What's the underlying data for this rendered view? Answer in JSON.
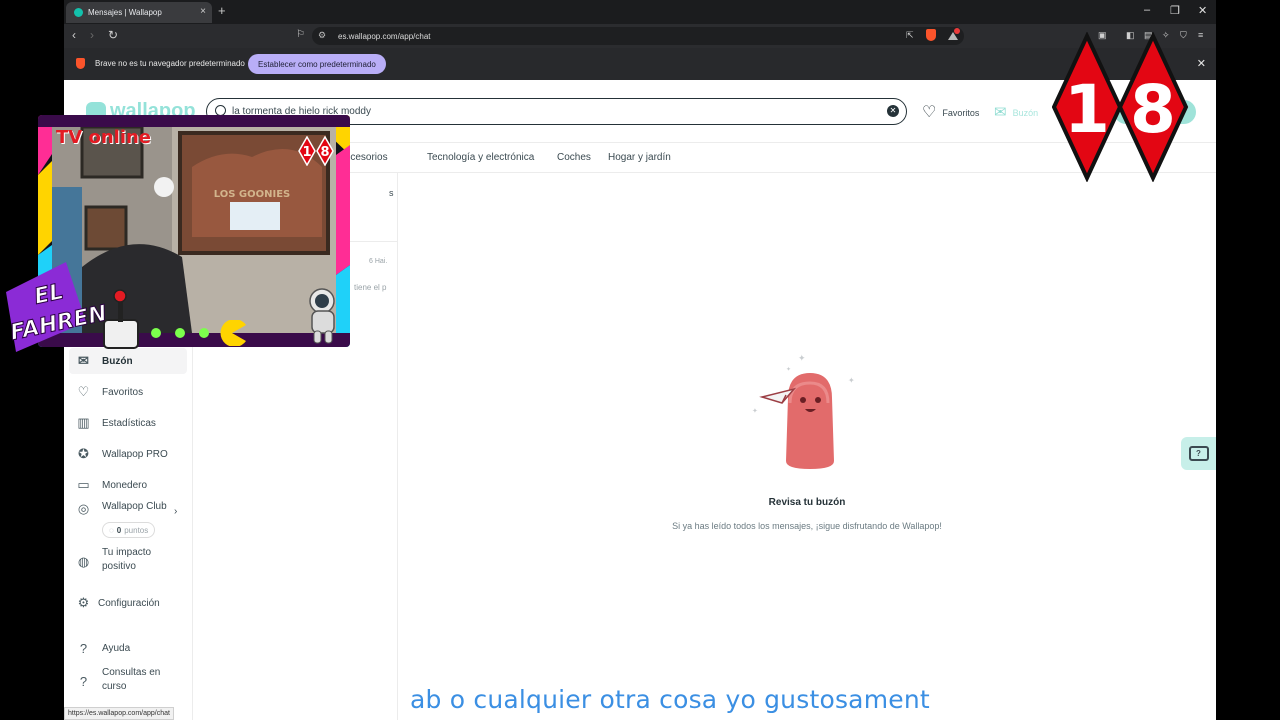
{
  "browser": {
    "tab_title": "Mensajes | Wallapop",
    "new_tab": "+",
    "url": "es.wallapop.com/app/chat",
    "window_controls": [
      "–",
      "❐",
      "✕"
    ],
    "infobar_message": "Brave no es tu navegador predeterminado",
    "infobar_button": "Establecer como predeterminado",
    "infobar_close": "✕",
    "status_url": "https://es.wallapop.com/app/chat"
  },
  "header": {
    "logo_text": "wallapop",
    "search_value": "la tormenta de hielo rick moddy",
    "favoritos": "Favoritos",
    "buzon": "Buzón"
  },
  "categories": [
    "y accesorios",
    "Tecnología y electrónica",
    "Coches",
    "Hogar y jardín"
  ],
  "sidebar": {
    "items": [
      {
        "label": "Buzón",
        "icon": "envelope-icon"
      },
      {
        "label": "Favoritos",
        "icon": "heart-icon"
      },
      {
        "label": "Estadísticas",
        "icon": "bar-chart-icon"
      },
      {
        "label": "Wallapop PRO",
        "icon": "verified-badge-icon"
      },
      {
        "label": "Monedero",
        "icon": "wallet-icon"
      },
      {
        "label": "Wallapop Club",
        "icon": "globe-icon"
      },
      {
        "label": "Tu impacto positivo",
        "icon": "earth-icon"
      },
      {
        "label": "Configuración",
        "icon": "gear-icon"
      },
      {
        "label": "Ayuda",
        "icon": "help-icon"
      },
      {
        "label": "Consultas en curso",
        "icon": "help-icon"
      }
    ],
    "points_value": "0",
    "points_label": "puntos"
  },
  "conversations": {
    "partial_letter": "s",
    "date": "6 Hai.",
    "snippet": "tiene el p"
  },
  "empty_state": {
    "title": "Revisa tu buzón",
    "subtitle": "Si ya has leído todos los mensajes, ¡sigue disfrutando de Wallapop!"
  },
  "overlays": {
    "age_rating": [
      "1",
      "8"
    ],
    "webcam_title": "TV online",
    "webcam_badge": [
      "1",
      "8"
    ],
    "streamer_logo": [
      "EL",
      "FAHREN"
    ],
    "poster_text": "LOS GOONIES",
    "subtitle_caption": "ab o cualquier otra cosa yo gustosament"
  },
  "colors": {
    "brand": "#13c1ac",
    "age_badge": "#e30613",
    "caption": "#3b8fe3"
  }
}
